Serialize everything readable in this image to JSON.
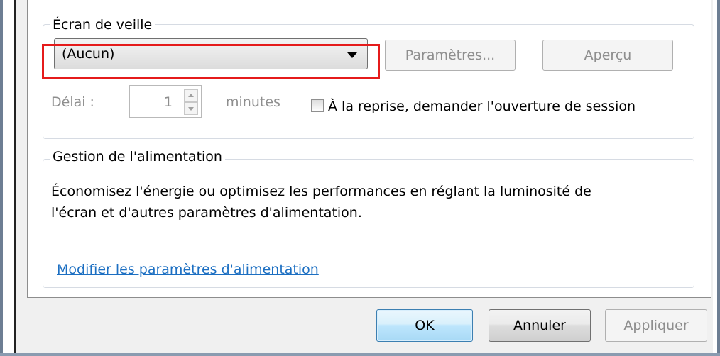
{
  "screensaver_group": {
    "title": "Écran de veille",
    "selected": "(Aucun)",
    "settings_button": "Paramètres...",
    "preview_button": "Aperçu",
    "delay_label": "Délai :",
    "delay_value": "1",
    "minutes_label": "minutes",
    "resume_checkbox_label": "À la reprise, demander l'ouverture de session",
    "resume_checked": false
  },
  "power_group": {
    "title": "Gestion de l'alimentation",
    "description_line1": "Économisez l'énergie ou optimisez les performances en réglant la luminosité de",
    "description_line2": "l'écran et d'autres paramètres d'alimentation.",
    "link": "Modifier les paramètres d'alimentation"
  },
  "buttons": {
    "ok": "OK",
    "cancel": "Annuler",
    "apply": "Appliquer"
  },
  "colors": {
    "highlight": "#e51b1b",
    "link": "#1c6fc2"
  }
}
